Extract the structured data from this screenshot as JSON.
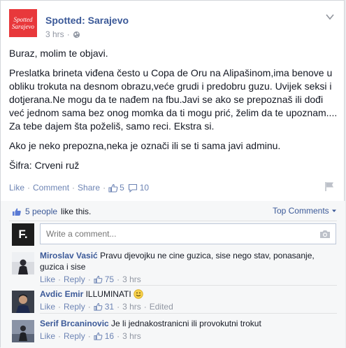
{
  "post": {
    "page_name": "Spotted: Sarajevo",
    "page_logo_line1": "Spotted",
    "page_logo_line2": "Sarajevo",
    "time": "3 hrs",
    "paragraphs": [
      "Buraz, molim te objavi.",
      "Preslatka brineta viđena često u Copa de Oru na Alipašinom,ima benove u obliku trokuta na desnom obrazu,veće grudi i predobru guzu. Uvijek seksi i dotjerana.Ne mogu da te nađem na fbu.Javi se ako se prepoznaš ili dođi već jednom sama bez onog momka da ti mogu prić, želim da te upoznam.... Za tebe dajem šta poželiš, samo reci. Ekstra si.",
      "Ako je neko prepozna,neka je označi ili se ti sama javi adminu.",
      "Šifra: Crveni ruž"
    ]
  },
  "actions": {
    "like": "Like",
    "comment": "Comment",
    "share": "Share",
    "like_count": "5",
    "comment_count": "10"
  },
  "ufi": {
    "likers": "5 people",
    "likers_suffix": "like this.",
    "top_comments": "Top Comments",
    "composer_avatar": "F.",
    "composer_placeholder": "Write a comment..."
  },
  "comments": [
    {
      "author": "Miroslav Vasić",
      "text": "Pravu djevojku ne cine guzica, sise nego stav, ponasanje, guzica i sise",
      "like": "Like",
      "reply": "Reply",
      "likes": "75",
      "time": "3 hrs",
      "edited": ""
    },
    {
      "author": "Avdic Emir",
      "text": "ILLUMINATI",
      "like": "Like",
      "reply": "Reply",
      "likes": "31",
      "time": "3 hrs",
      "edited": "Edited"
    },
    {
      "author": "Serif Brcaninovic",
      "text": "Je li jednakostranicni ili provokutni trokut",
      "like": "Like",
      "reply": "Reply",
      "likes": "16",
      "time": "3 hrs",
      "edited": ""
    }
  ],
  "colors": {
    "link": "#3b5998",
    "muted": "#9197a3",
    "logo": "#e8383b"
  },
  "icons": [
    "globe-icon",
    "chevron-down-icon",
    "thumbs-up-icon",
    "comment-bubble-icon",
    "flag-icon",
    "camera-icon",
    "smiley-icon"
  ]
}
